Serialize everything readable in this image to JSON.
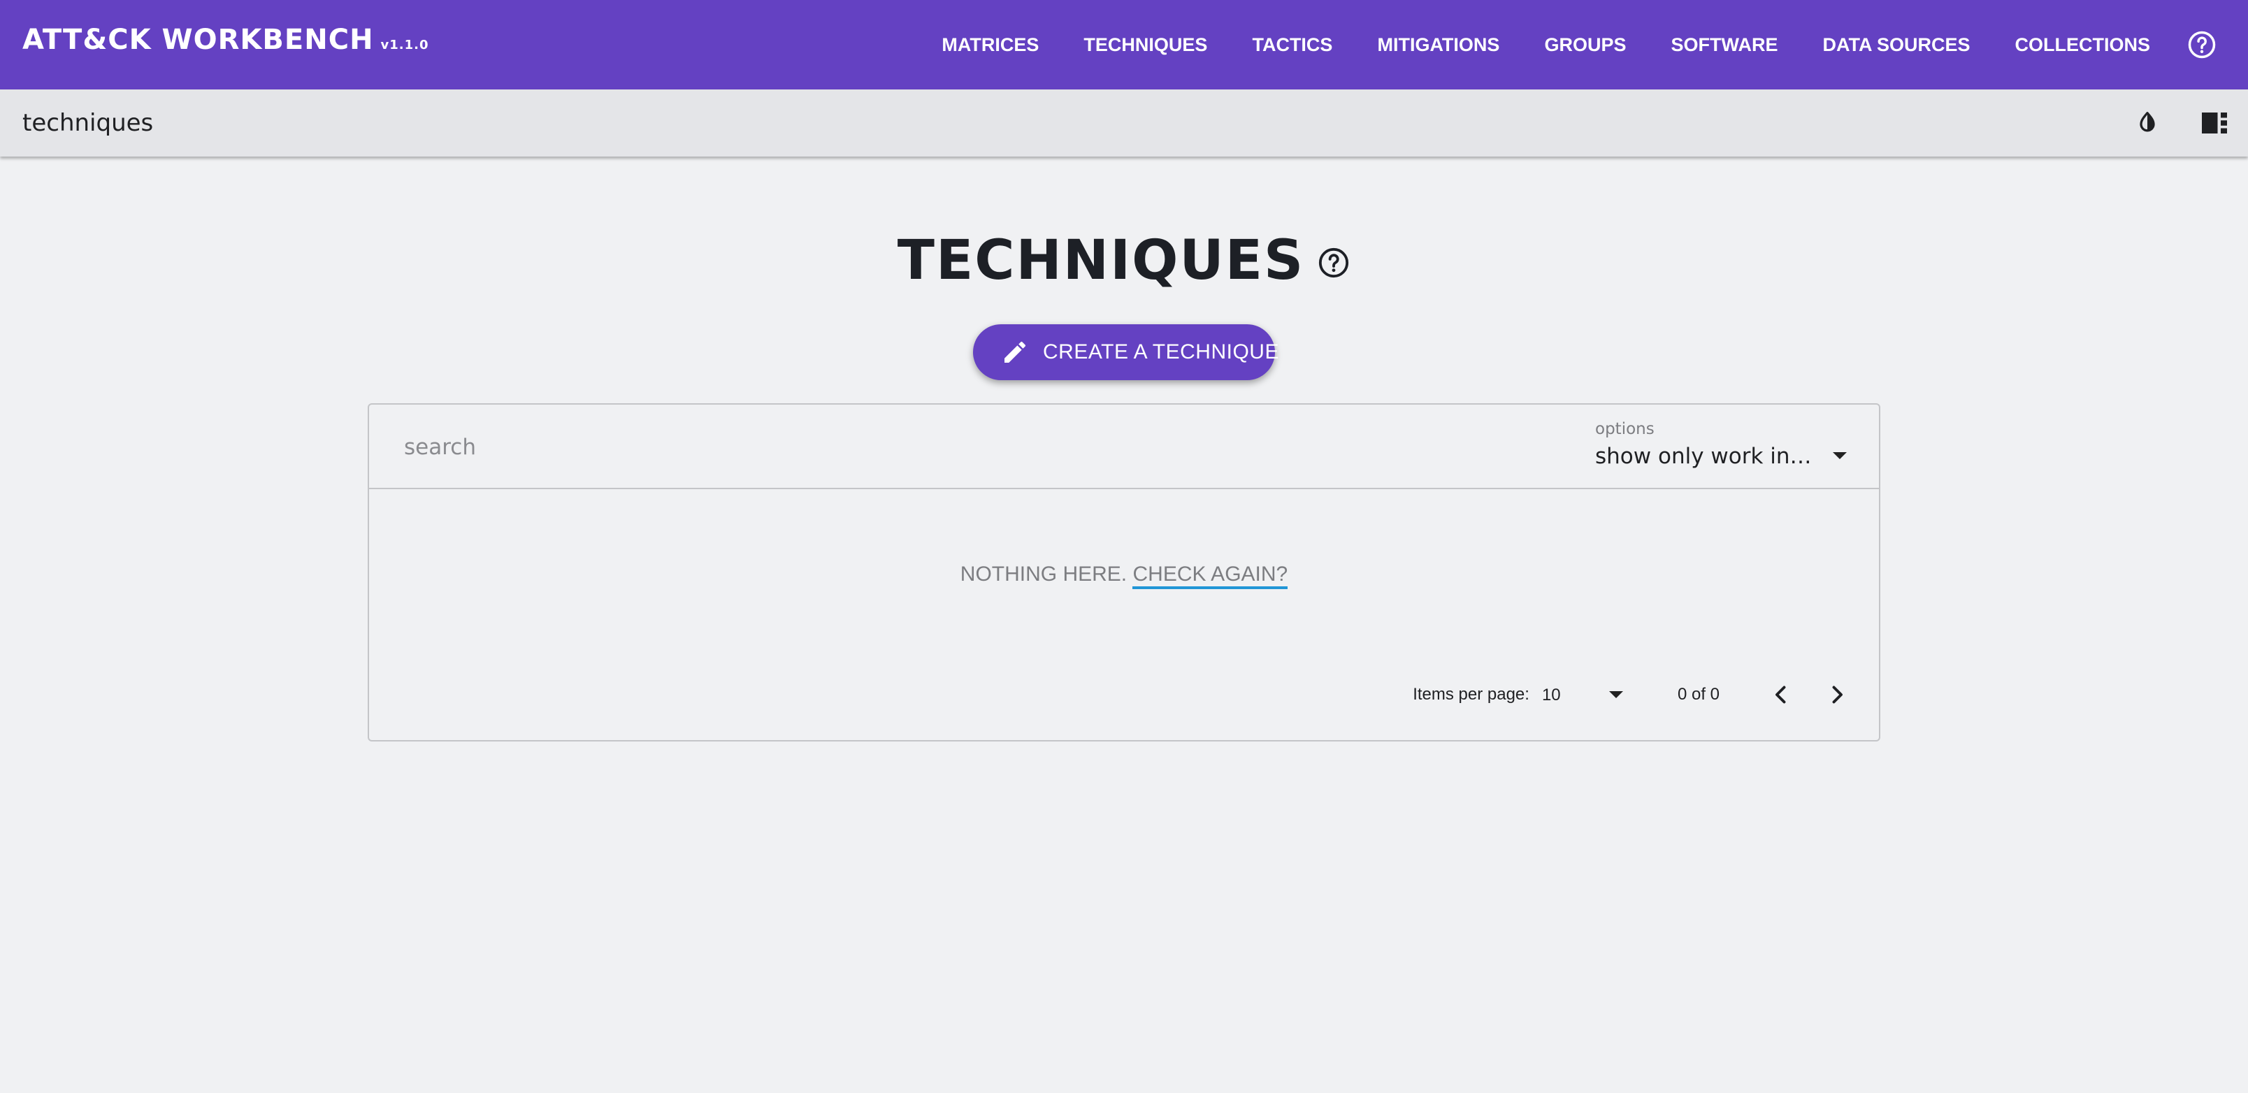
{
  "header": {
    "brand_title": "ATT&CK WORKBENCH",
    "brand_version": "v1.1.0",
    "nav": [
      "MATRICES",
      "TECHNIQUES",
      "TACTICS",
      "MITIGATIONS",
      "GROUPS",
      "SOFTWARE",
      "DATA SOURCES",
      "COLLECTIONS"
    ],
    "help_icon": "help-circle-icon"
  },
  "subheader": {
    "title": "techniques",
    "icons": [
      "theme-contrast-icon",
      "sidebar-toggle-icon"
    ]
  },
  "page": {
    "title": "TECHNIQUES",
    "help_icon": "help-circle-icon",
    "create_button_label": "CREATE A TECHNIQUE",
    "create_button_icon": "pencil-icon"
  },
  "table": {
    "search_placeholder": "search",
    "options_label": "options",
    "options_value": "show only work in progress",
    "empty_text": "NOTHING HERE.",
    "empty_link": "CHECK AGAIN?",
    "paginator": {
      "items_per_page_label": "Items per page:",
      "items_per_page_value": "10",
      "range_label": "0 of 0"
    }
  },
  "colors": {
    "primary": "#6441c2",
    "background": "#f0f1f3",
    "subheader": "#e4e5e8",
    "link_underline": "#2196d6"
  }
}
